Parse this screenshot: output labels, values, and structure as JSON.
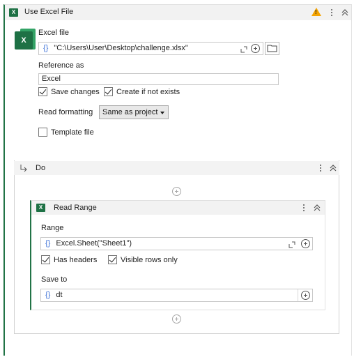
{
  "use_excel": {
    "title": "Use Excel File",
    "excel_file_label": "Excel file",
    "excel_file_value": "\"C:\\Users\\User\\Desktop\\challenge.xlsx\"",
    "reference_label": "Reference as",
    "reference_value": "Excel",
    "save_changes_label": "Save changes",
    "save_changes_checked": true,
    "create_if_not_exists_label": "Create if not exists",
    "create_if_not_exists_checked": true,
    "read_formatting_label": "Read formatting",
    "read_formatting_value": "Same as project",
    "template_file_label": "Template file",
    "template_file_checked": false
  },
  "do": {
    "title": "Do"
  },
  "read_range": {
    "title": "Read Range",
    "range_label": "Range",
    "range_value": "Excel.Sheet(\"Sheet1\")",
    "has_headers_label": "Has headers",
    "has_headers_checked": true,
    "visible_rows_label": "Visible rows only",
    "visible_rows_checked": true,
    "save_to_label": "Save to",
    "save_to_value": "dt"
  },
  "icons": {
    "brace": "{}",
    "excel_badge": "X",
    "warning_mark": "!"
  },
  "colors": {
    "excel_green": "#217346",
    "warning": "#f4a300",
    "brace_blue": "#3a6fd6"
  }
}
